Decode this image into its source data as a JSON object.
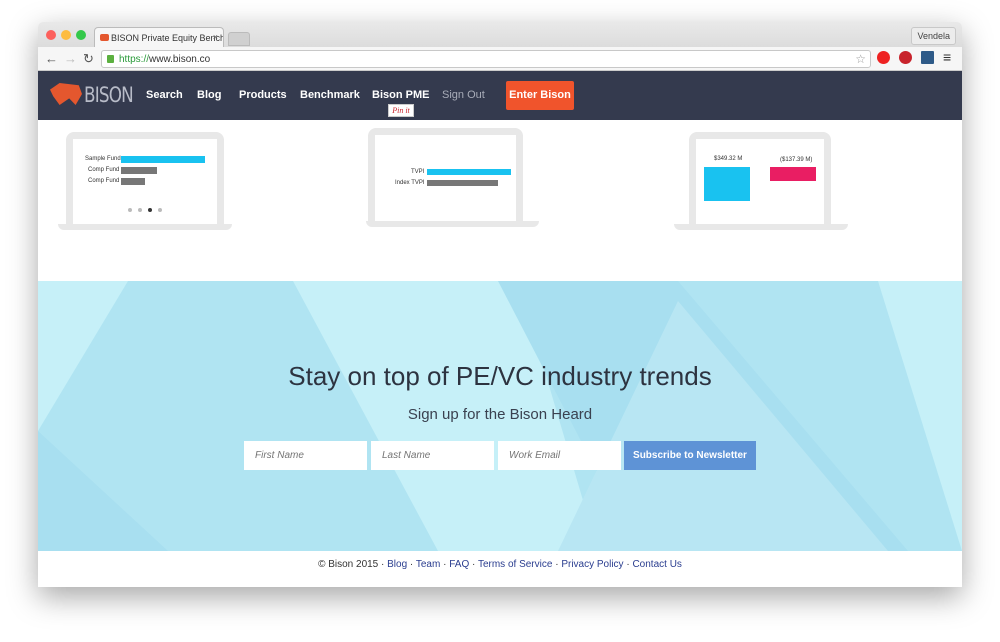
{
  "browser": {
    "tab_title": "BISON Private Equity Bench",
    "user": "Vendela",
    "url_scheme": "https://",
    "url_host": "www.bison.co"
  },
  "nav": {
    "logo": "BISON",
    "links": [
      "Search",
      "Blog",
      "Products",
      "Benchmark",
      "Bison PME",
      "Sign Out"
    ],
    "cta": "Enter Bison",
    "pin_it": "Pin it"
  },
  "laptops": {
    "fund_chart": {
      "labels": [
        "Sample Fund",
        "Comp Fund",
        "Comp Fund"
      ]
    },
    "tvpi_chart": {
      "labels": [
        "TVPI",
        "Index TVPI"
      ]
    },
    "value_chart": {
      "labels": [
        "$349.32 M",
        "($137.39 M)"
      ]
    }
  },
  "colors": {
    "nav_bg": "#343a4e",
    "accent": "#f0542c",
    "cyan": "#19c2f0",
    "pink": "#e91e63",
    "subscribe": "#5e93d6"
  },
  "hero": {
    "title": "Stay on top of PE/VC industry trends",
    "subtitle": "Sign up for the Bison Heard",
    "first_name_placeholder": "First Name",
    "last_name_placeholder": "Last Name",
    "email_placeholder": "Work Email",
    "subscribe": "Subscribe to Newsletter"
  },
  "footer": {
    "copyright": "© Bison 2015",
    "links": [
      "Blog",
      "Team",
      "FAQ",
      "Terms of Service",
      "Privacy Policy",
      "Contact Us"
    ]
  }
}
